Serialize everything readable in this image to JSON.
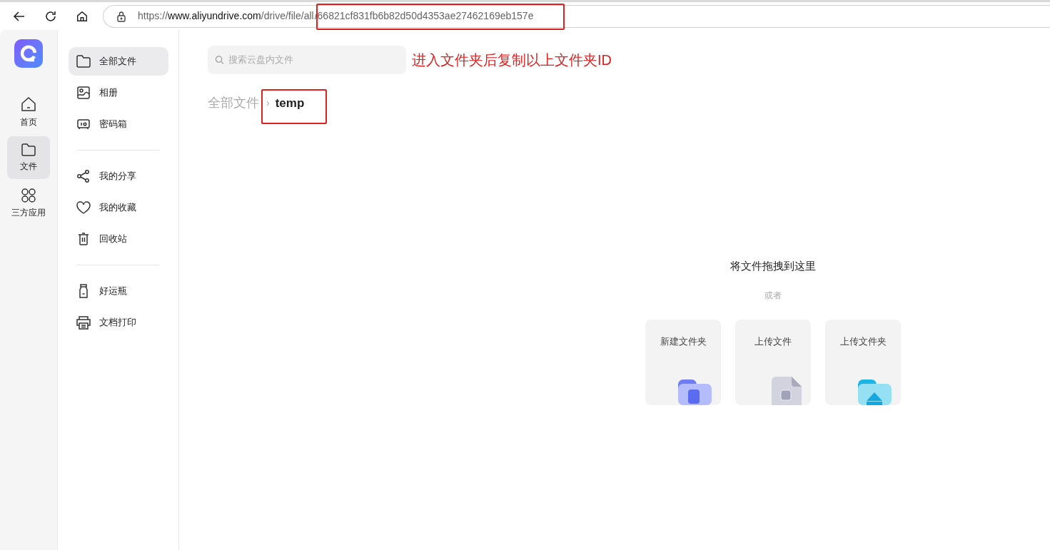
{
  "browser": {
    "url_scheme": "https://",
    "url_host": "www.aliyundrive.com",
    "url_path": "/drive/file/all",
    "url_id": "/66821cf831fb6b82d50d4353ae27462169eb157e"
  },
  "rail": [
    {
      "label": "首页",
      "selected": false
    },
    {
      "label": "文件",
      "selected": true
    },
    {
      "label": "三方应用",
      "selected": false
    }
  ],
  "nav_groups": [
    [
      {
        "label": "全部文件",
        "selected": true
      },
      {
        "label": "相册",
        "selected": false
      },
      {
        "label": "密码箱",
        "selected": false
      }
    ],
    [
      {
        "label": "我的分享",
        "selected": false
      },
      {
        "label": "我的收藏",
        "selected": false
      },
      {
        "label": "回收站",
        "selected": false
      }
    ],
    [
      {
        "label": "好运瓶",
        "selected": false
      },
      {
        "label": "文档打印",
        "selected": false
      }
    ]
  ],
  "search": {
    "placeholder": "搜索云盘内文件"
  },
  "annotation_note": "进入文件夹后复制以上文件夹ID",
  "breadcrumb": [
    {
      "label": "全部文件",
      "current": false
    },
    {
      "label": "temp",
      "current": true
    }
  ],
  "breadcrumb_separator": "›",
  "drop_zone": {
    "title": "将文件拖拽到这里",
    "or": "或者",
    "actions": [
      {
        "label": "新建文件夹",
        "kind": "new-folder"
      },
      {
        "label": "上传文件",
        "kind": "upload-file"
      },
      {
        "label": "上传文件夹",
        "kind": "upload-folder"
      }
    ]
  }
}
